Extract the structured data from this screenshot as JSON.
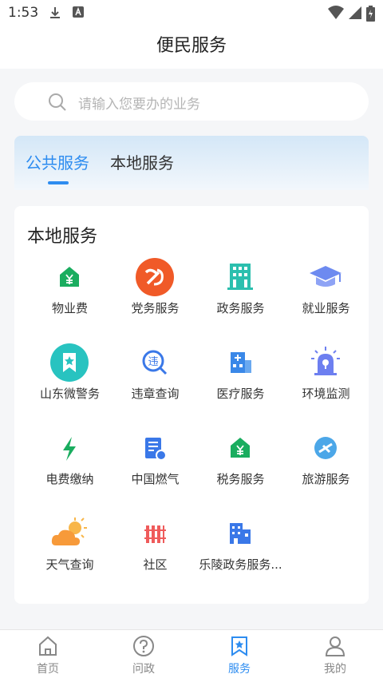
{
  "status": {
    "time": "1:53"
  },
  "header": {
    "title": "便民服务"
  },
  "search": {
    "placeholder": "请输入您要办的业务"
  },
  "tabs": [
    {
      "label": "公共服务"
    },
    {
      "label": "本地服务"
    }
  ],
  "section": {
    "title": "本地服务"
  },
  "services": [
    {
      "label": "物业费",
      "icon": "house-yen-icon"
    },
    {
      "label": "党务服务",
      "icon": "party-emblem-icon"
    },
    {
      "label": "政务服务",
      "icon": "government-building-icon"
    },
    {
      "label": "就业服务",
      "icon": "graduation-cap-icon"
    },
    {
      "label": "山东微警务",
      "icon": "police-badge-icon"
    },
    {
      "label": "违章查询",
      "icon": "violation-search-icon"
    },
    {
      "label": "医疗服务",
      "icon": "hospital-icon"
    },
    {
      "label": "环境监测",
      "icon": "alarm-light-icon"
    },
    {
      "label": "电费缴纳",
      "icon": "lightning-icon"
    },
    {
      "label": "中国燃气",
      "icon": "gas-document-icon"
    },
    {
      "label": "税务服务",
      "icon": "house-yen-icon"
    },
    {
      "label": "旅游服务",
      "icon": "globe-plane-icon"
    },
    {
      "label": "天气查询",
      "icon": "weather-sun-cloud-icon"
    },
    {
      "label": "社区",
      "icon": "community-icon"
    },
    {
      "label": "乐陵政务服务...",
      "icon": "city-buildings-icon"
    }
  ],
  "tabbar": [
    {
      "label": "首页",
      "icon": "home-icon"
    },
    {
      "label": "问政",
      "icon": "question-icon"
    },
    {
      "label": "服务",
      "icon": "star-bookmark-icon"
    },
    {
      "label": "我的",
      "icon": "user-icon"
    }
  ],
  "colors": {
    "accent": "#2d8cf0",
    "green": "#1aad5f",
    "red": "#f05a28",
    "teal": "#2bbfae"
  }
}
